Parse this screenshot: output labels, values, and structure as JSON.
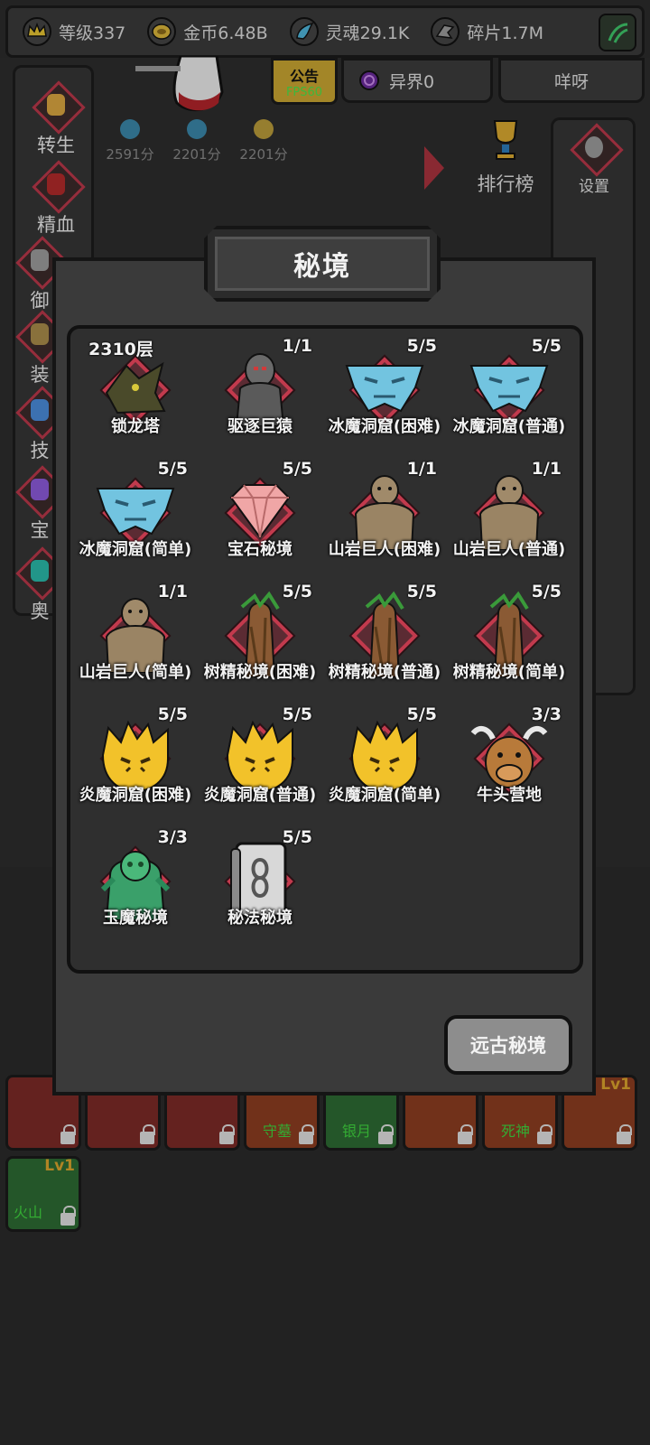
{
  "topbar": {
    "level": "等级337",
    "gold": "金币6.48B",
    "soul": "灵魂29.1K",
    "shard": "碎片1.7M"
  },
  "tabs": {
    "notice": "公告",
    "fps": "FPS60",
    "realm": "异界0",
    "yaya": "咩呀"
  },
  "scores": [
    "2591分",
    "2201分",
    "2201分"
  ],
  "left_menu": [
    "转生",
    "精血",
    "御",
    "装",
    "技",
    "宝",
    "奥"
  ],
  "right_menu": {
    "settings": "设置",
    "ranking": "排行榜"
  },
  "modal": {
    "title": "秘境",
    "ancient_button": "远古秘境",
    "cells": [
      {
        "name": "锁龙塔",
        "count": "2310层",
        "icon": "dragon-icon"
      },
      {
        "name": "驱逐巨猿",
        "count": "1/1",
        "icon": "ape-icon"
      },
      {
        "name": "冰魔洞窟(困难)",
        "count": "5/5",
        "icon": "ice-demon-icon"
      },
      {
        "name": "冰魔洞窟(普通)",
        "count": "5/5",
        "icon": "ice-demon-icon"
      },
      {
        "name": "冰魔洞窟(简单)",
        "count": "5/5",
        "icon": "ice-demon-icon"
      },
      {
        "name": "宝石秘境",
        "count": "5/5",
        "icon": "gem-icon"
      },
      {
        "name": "山岩巨人(困难)",
        "count": "1/1",
        "icon": "rock-giant-icon"
      },
      {
        "name": "山岩巨人(普通)",
        "count": "1/1",
        "icon": "rock-giant-icon"
      },
      {
        "name": "山岩巨人(简单)",
        "count": "1/1",
        "icon": "rock-giant-icon"
      },
      {
        "name": "树精秘境(困难)",
        "count": "5/5",
        "icon": "treant-icon"
      },
      {
        "name": "树精秘境(普通)",
        "count": "5/5",
        "icon": "treant-icon"
      },
      {
        "name": "树精秘境(简单)",
        "count": "5/5",
        "icon": "treant-icon"
      },
      {
        "name": "炎魔洞窟(困难)",
        "count": "5/5",
        "icon": "fire-demon-icon"
      },
      {
        "name": "炎魔洞窟(普通)",
        "count": "5/5",
        "icon": "fire-demon-icon"
      },
      {
        "name": "炎魔洞窟(简单)",
        "count": "5/5",
        "icon": "fire-demon-icon"
      },
      {
        "name": "牛头营地",
        "count": "3/3",
        "icon": "minotaur-icon"
      },
      {
        "name": "玉魔秘境",
        "count": "3/3",
        "icon": "jade-demon-icon"
      },
      {
        "name": "秘法秘境",
        "count": "5/5",
        "icon": "arcane-book-icon"
      }
    ]
  },
  "equipment": {
    "slots": [
      "守墓",
      "银月",
      "死神",
      "火山"
    ],
    "levels": [
      "Lv1",
      "Lv1"
    ]
  }
}
